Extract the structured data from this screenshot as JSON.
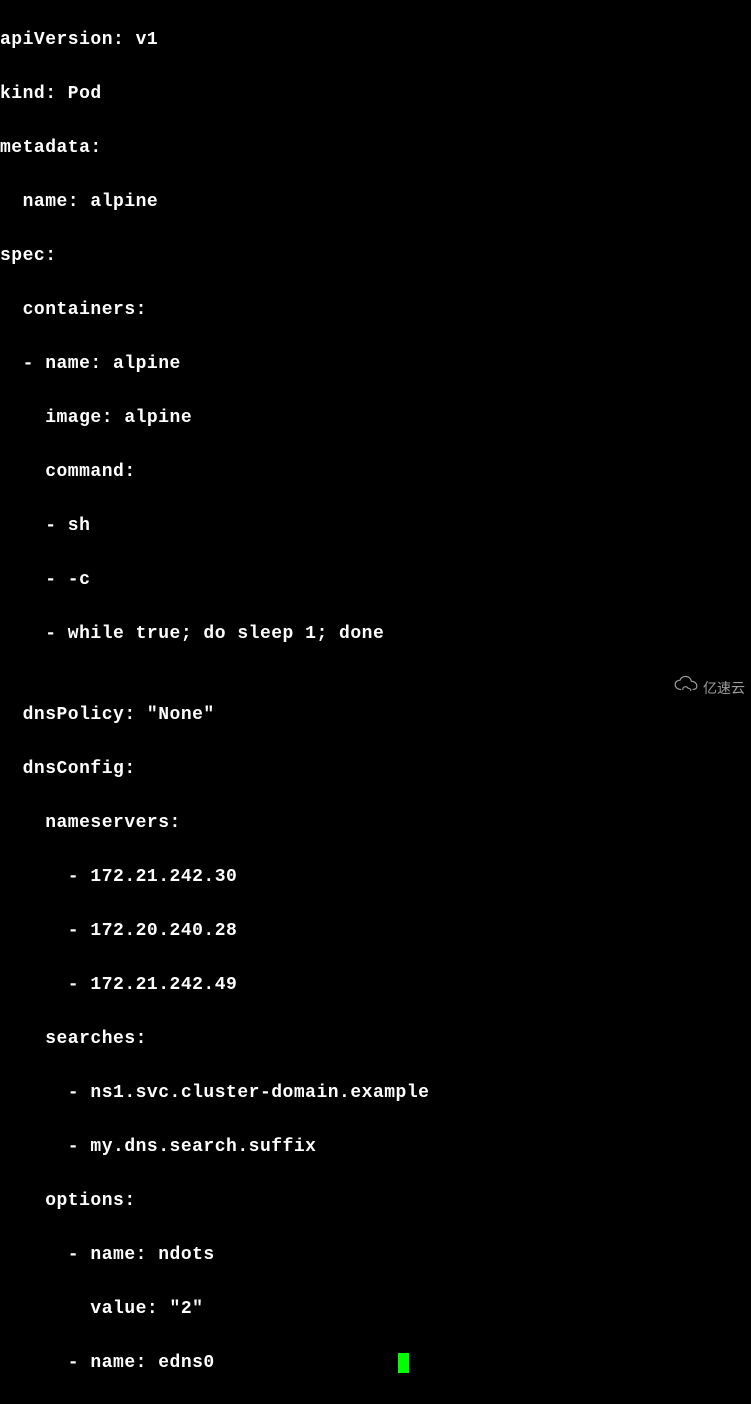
{
  "yaml": {
    "l1": "apiVersion: v1",
    "l2": "kind: Pod",
    "l3": "metadata:",
    "l4": "  name: alpine",
    "l5": "spec:",
    "l6": "  containers:",
    "l7": "  - name: alpine",
    "l8": "    image: alpine",
    "l9": "    command:",
    "l10": "    - sh",
    "l11": "    - -c",
    "l12": "    - while true; do sleep 1; done",
    "l13": "",
    "l14": "  dnsPolicy: \"None\"",
    "l15": "  dnsConfig:",
    "l16": "    nameservers:",
    "l17": "      - 172.21.242.30",
    "l18": "      - 172.20.240.28",
    "l19": "      - 172.21.242.49",
    "l20": "    searches:",
    "l21": "      - ns1.svc.cluster-domain.example",
    "l22": "      - my.dns.search.suffix",
    "l23": "    options:",
    "l24": "      - name: ndots",
    "l25": "        value: \"2\"",
    "l26": "      - name: edns0"
  },
  "watermark": {
    "text": "亿速云"
  }
}
